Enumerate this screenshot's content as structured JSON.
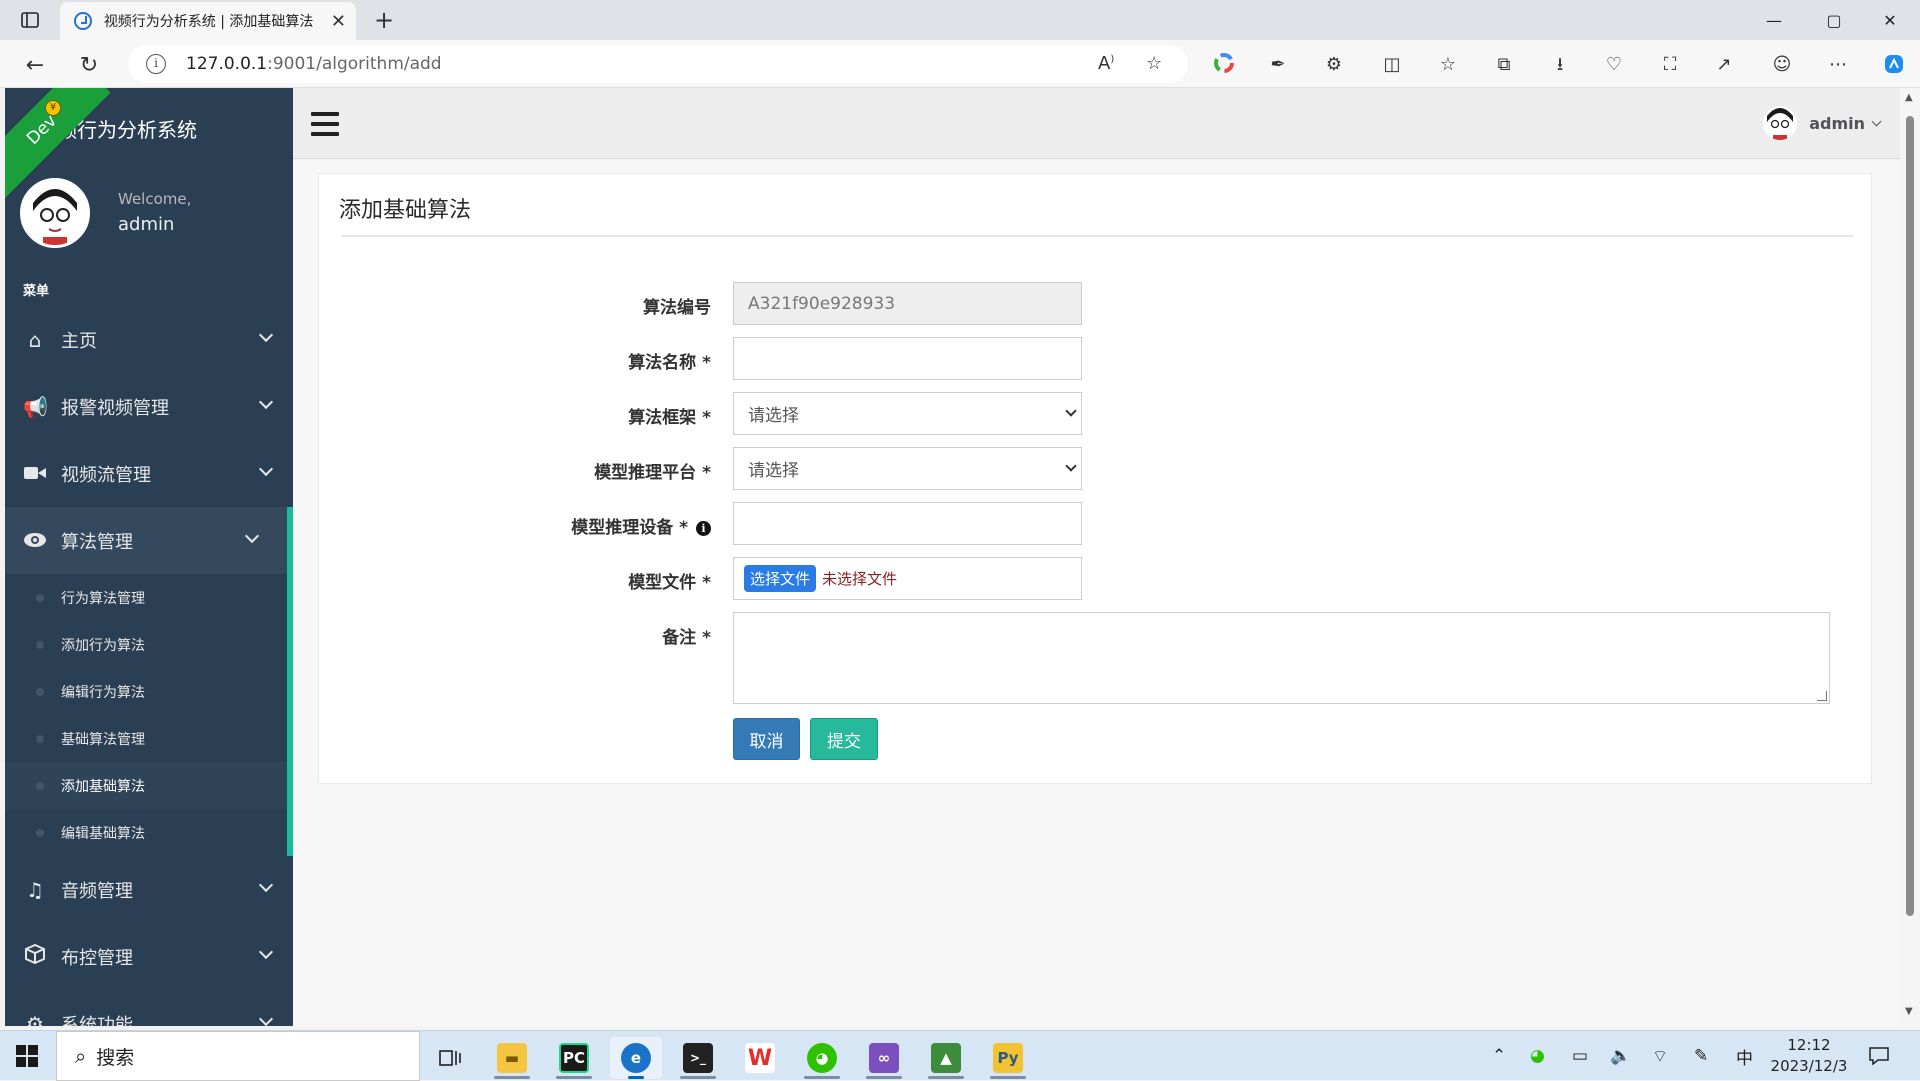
{
  "browser": {
    "tab_title": "视频行为分析系统 | 添加基础算法",
    "tab_close": "✕",
    "new_tab": "+",
    "url_host": "127.0.0.1",
    "url_rest": ":9001/algorithm/add",
    "window_controls": [
      "—",
      "▢",
      "✕"
    ]
  },
  "sidebar": {
    "title": "视频行为分析系统",
    "title_visible": "频行为分析系统",
    "ribbon": "Dev",
    "welcome": "Welcome,",
    "username": "admin",
    "section": "菜单",
    "menu": [
      {
        "label": "主页",
        "icon": "home-icon"
      },
      {
        "label": "报警视频管理",
        "icon": "bullhorn-icon"
      },
      {
        "label": "视频流管理",
        "icon": "video-camera-icon"
      },
      {
        "label": "算法管理",
        "icon": "eye-icon"
      },
      {
        "label": "音频管理",
        "icon": "music-icon"
      },
      {
        "label": "布控管理",
        "icon": "cube-icon"
      },
      {
        "label": "系统功能",
        "icon": "gear-icon"
      }
    ],
    "submenu": [
      "行为算法管理",
      "添加行为算法",
      "编辑行为算法",
      "基础算法管理",
      "添加基础算法",
      "编辑基础算法"
    ]
  },
  "topnav": {
    "username": "admin"
  },
  "form": {
    "title": "添加基础算法",
    "fields": {
      "code_label": "算法编号",
      "code_value": "A321f90e928933",
      "name_label": "算法名称 *",
      "name_value": "",
      "framework_label": "算法框架 *",
      "framework_selected": "请选择",
      "platform_label": "模型推理平台 *",
      "platform_selected": "请选择",
      "device_label": "模型推理设备 *",
      "device_value": "",
      "file_label": "模型文件 *",
      "file_button": "选择文件",
      "file_status": "未选择文件",
      "remark_label": "备注 *",
      "remark_value": ""
    },
    "cancel": "取消",
    "submit": "提交"
  },
  "taskbar": {
    "search_placeholder": "搜索",
    "time": "12:12",
    "date": "2023/12/3",
    "ime": "中"
  },
  "colors": {
    "sidebar_bg": "#2a3f54",
    "accent_green": "#1abb9c",
    "cancel_blue": "#337ab7",
    "submit_green": "#26b99a"
  }
}
